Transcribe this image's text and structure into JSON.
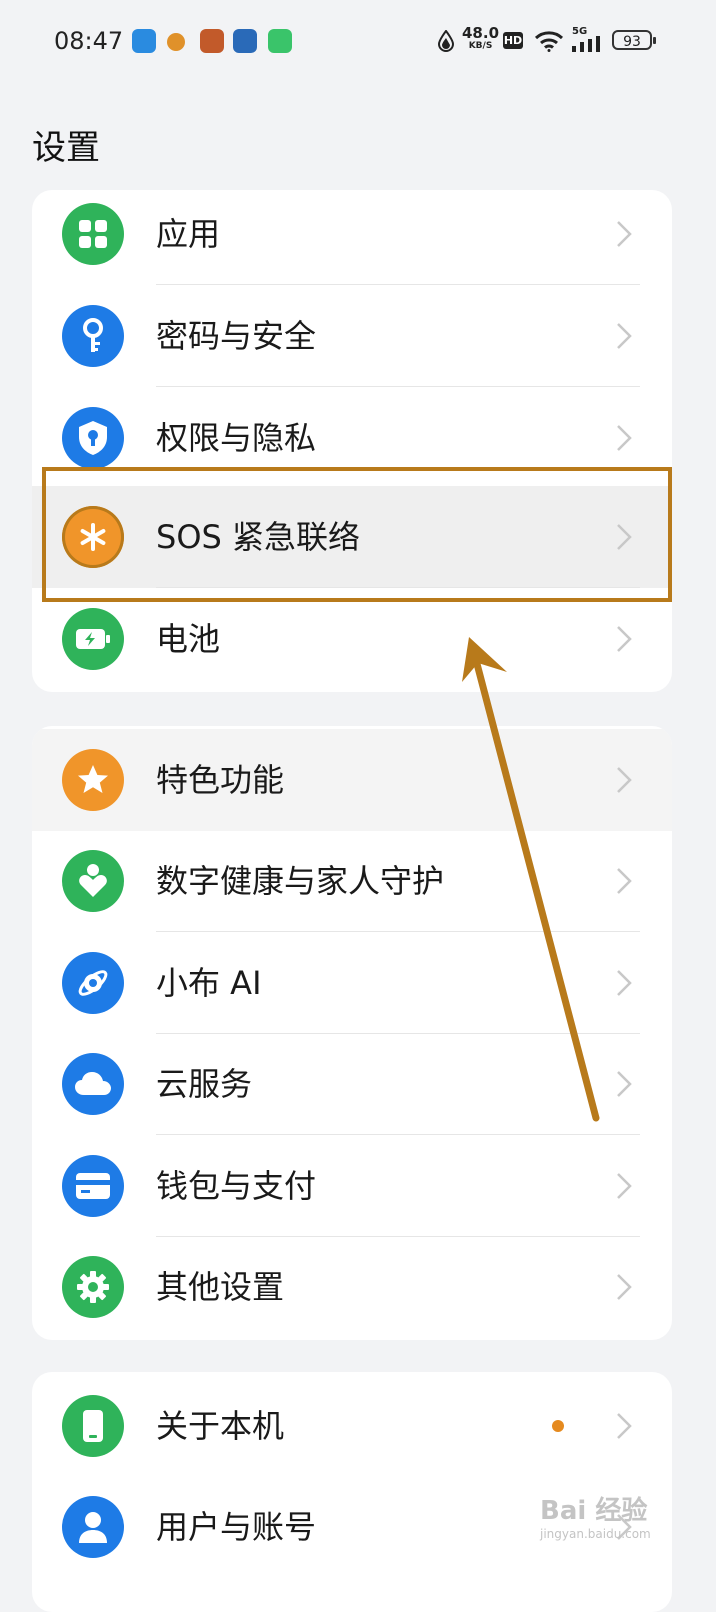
{
  "status_bar": {
    "time": "08:47",
    "net_speed_value": "48.0",
    "net_speed_unit": "KB/S",
    "hd": "HD",
    "network": "5G",
    "battery": "93"
  },
  "header": {
    "title": "设置"
  },
  "groups": [
    {
      "items": [
        {
          "label": "应用",
          "icon": "apps-grid-icon",
          "color": "#2fb35a"
        },
        {
          "label": "密码与安全",
          "icon": "key-icon",
          "color": "#1e7be6"
        },
        {
          "label": "权限与隐私",
          "icon": "shield-lock-icon",
          "color": "#1e7be6"
        },
        {
          "label": "SOS 紧急联络",
          "icon": "asterisk-icon",
          "color": "#f0952a"
        },
        {
          "label": "电池",
          "icon": "battery-charging-icon",
          "color": "#2fb35a"
        }
      ]
    },
    {
      "items": [
        {
          "label": "特色功能",
          "icon": "star-icon",
          "color": "#f0952a"
        },
        {
          "label": "数字健康与家人守护",
          "icon": "person-heart-icon",
          "color": "#2fb35a"
        },
        {
          "label": "小布 AI",
          "icon": "orbit-ai-icon",
          "color": "#1e7be6"
        },
        {
          "label": "云服务",
          "icon": "cloud-icon",
          "color": "#1e7be6"
        },
        {
          "label": "钱包与支付",
          "icon": "card-icon",
          "color": "#1e7be6"
        },
        {
          "label": "其他设置",
          "icon": "gear-icon",
          "color": "#2fb35a"
        }
      ]
    },
    {
      "items": [
        {
          "label": "关于本机",
          "icon": "phone-icon",
          "color": "#2fb35a",
          "badge": true
        },
        {
          "label": "用户与账号",
          "icon": "user-icon",
          "color": "#1e7be6"
        }
      ]
    }
  ],
  "annotation": {
    "color": "#b87a1b",
    "highlighted_item": "SOS 紧急联络"
  },
  "watermark": {
    "text": "Bai 经验",
    "sub": "jingyan.baidu.com"
  }
}
